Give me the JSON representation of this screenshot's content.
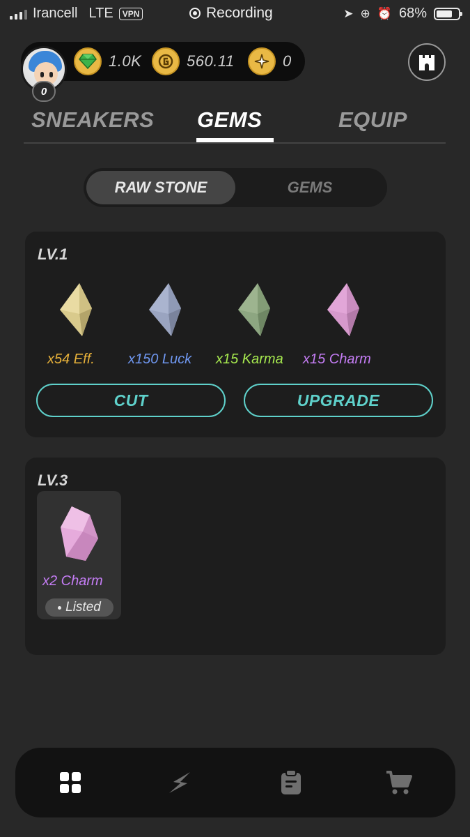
{
  "status_bar": {
    "carrier": "Irancell",
    "network": "LTE",
    "vpn": "VPN",
    "center_label": "Recording",
    "battery": "68%",
    "battery_level": 0.68
  },
  "header": {
    "level": "0",
    "currencies": [
      {
        "icon": "gem-token-icon",
        "value": "1.0K"
      },
      {
        "icon": "gst-coin-icon",
        "value": "560.11"
      },
      {
        "icon": "sparkle-coin-icon",
        "value": "0"
      }
    ],
    "castle_icon": "castle-icon"
  },
  "tabs": [
    {
      "label": "SNEAKERS",
      "active": false
    },
    {
      "label": "GEMS",
      "active": true
    },
    {
      "label": "EQUIP",
      "active": false
    }
  ],
  "segment": [
    {
      "label": "RAW STONE",
      "active": true
    },
    {
      "label": "GEMS",
      "active": false
    }
  ],
  "lv1": {
    "title": "LV.1",
    "gems": [
      {
        "label": "x54 Eff.",
        "color": "#e8b23a",
        "gem_color": "#e9dba3"
      },
      {
        "label": "x150 Luck",
        "color": "#6f97f0",
        "gem_color": "#aab4cf"
      },
      {
        "label": "x15 Karma",
        "color": "#a7ea4f",
        "gem_color": "#9db48f"
      },
      {
        "label": "x15 Charm",
        "color": "#c57df5",
        "gem_color": "#e2a6d8"
      }
    ],
    "cut_label": "CUT",
    "upgrade_label": "UPGRADE"
  },
  "lv3": {
    "title": "LV.3",
    "gem": {
      "label": "x2 Charm",
      "color": "#c57df5",
      "gem_color": "#e6abdc",
      "status": "Listed"
    }
  },
  "bottom_nav": [
    {
      "icon": "grid-icon",
      "active": true
    },
    {
      "icon": "lightning-icon",
      "active": false
    },
    {
      "icon": "clipboard-icon",
      "active": false
    },
    {
      "icon": "cart-icon",
      "active": false
    }
  ]
}
